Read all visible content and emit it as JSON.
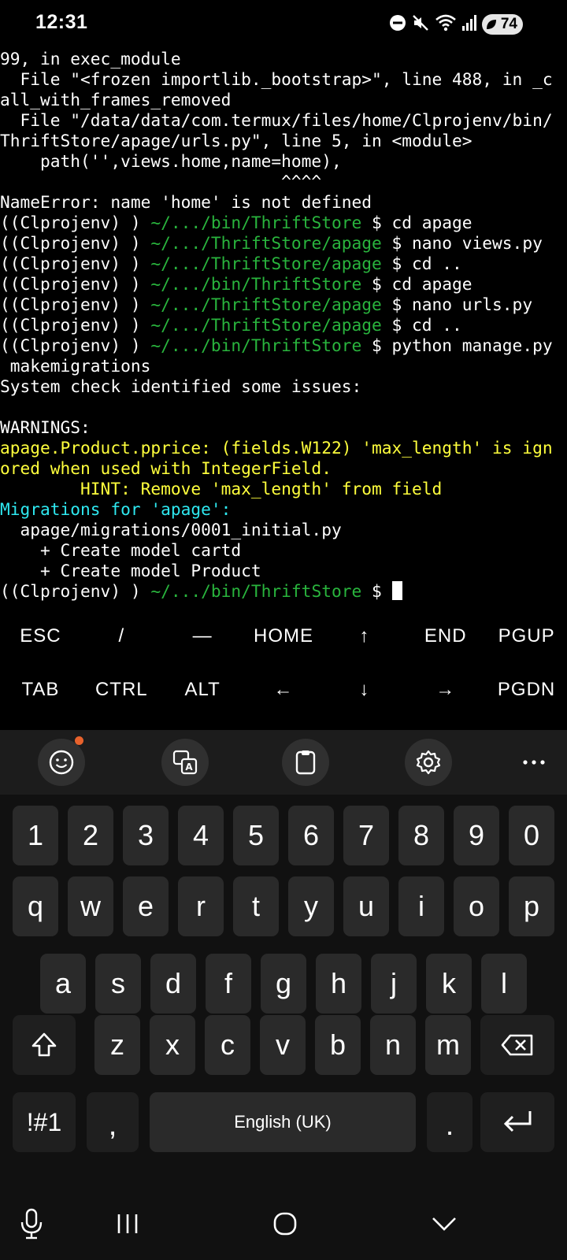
{
  "status_bar": {
    "time": "12:31",
    "battery": "74"
  },
  "terminal": {
    "lines": [
      [
        {
          "t": "99, in exec_module",
          "c": ""
        }
      ],
      [
        {
          "t": "  File \"<frozen importlib._bootstrap>\", line 488, in _c",
          "c": ""
        }
      ],
      [
        {
          "t": "all_with_frames_removed",
          "c": ""
        }
      ],
      [
        {
          "t": "  File \"/data/data/com.termux/files/home/Clprojenv/bin/",
          "c": ""
        }
      ],
      [
        {
          "t": "ThriftStore/apage/urls.py\", line 5, in <module>",
          "c": ""
        }
      ],
      [
        {
          "t": "    path('',views.home,name=home),",
          "c": ""
        }
      ],
      [
        {
          "t": "                            ^^^^",
          "c": ""
        }
      ],
      [
        {
          "t": "NameError: name 'home' is not defined",
          "c": ""
        }
      ],
      [
        {
          "t": "((Clprojenv) ) ",
          "c": ""
        },
        {
          "t": "~/.../bin/ThriftStore",
          "c": "g"
        },
        {
          "t": " $ cd apage",
          "c": ""
        }
      ],
      [
        {
          "t": "((Clprojenv) ) ",
          "c": ""
        },
        {
          "t": "~/.../ThriftStore/apage",
          "c": "g"
        },
        {
          "t": " $ nano views.py",
          "c": ""
        }
      ],
      [
        {
          "t": "((Clprojenv) ) ",
          "c": ""
        },
        {
          "t": "~/.../ThriftStore/apage",
          "c": "g"
        },
        {
          "t": " $ cd ..",
          "c": ""
        }
      ],
      [
        {
          "t": "((Clprojenv) ) ",
          "c": ""
        },
        {
          "t": "~/.../bin/ThriftStore",
          "c": "g"
        },
        {
          "t": " $ cd apage",
          "c": ""
        }
      ],
      [
        {
          "t": "((Clprojenv) ) ",
          "c": ""
        },
        {
          "t": "~/.../ThriftStore/apage",
          "c": "g"
        },
        {
          "t": " $ nano urls.py",
          "c": ""
        }
      ],
      [
        {
          "t": "((Clprojenv) ) ",
          "c": ""
        },
        {
          "t": "~/.../ThriftStore/apage",
          "c": "g"
        },
        {
          "t": " $ cd ..",
          "c": ""
        }
      ],
      [
        {
          "t": "((Clprojenv) ) ",
          "c": ""
        },
        {
          "t": "~/.../bin/ThriftStore",
          "c": "g"
        },
        {
          "t": " $ python manage.py",
          "c": ""
        }
      ],
      [
        {
          "t": " makemigrations",
          "c": ""
        }
      ],
      [
        {
          "t": "System check identified some issues:",
          "c": ""
        }
      ],
      [
        {
          "t": "",
          "c": ""
        }
      ],
      [
        {
          "t": "WARNINGS:",
          "c": ""
        }
      ],
      [
        {
          "t": "apage.Product.pprice: (fields.W122) 'max_length' is ign",
          "c": "y"
        }
      ],
      [
        {
          "t": "ored when used with IntegerField.",
          "c": "y"
        }
      ],
      [
        {
          "t": "        HINT: Remove 'max_length' from field",
          "c": "y"
        }
      ],
      [
        {
          "t": "Migrations for 'apage':",
          "c": "c"
        }
      ],
      [
        {
          "t": "  apage/migrations/0001_initial.py",
          "c": ""
        }
      ],
      [
        {
          "t": "    + Create model cartd",
          "c": ""
        }
      ],
      [
        {
          "t": "    + Create model Product",
          "c": ""
        }
      ],
      [
        {
          "t": "((Clprojenv) ) ",
          "c": ""
        },
        {
          "t": "~/.../bin/ThriftStore",
          "c": "g"
        },
        {
          "t": " $ ",
          "c": ""
        }
      ]
    ]
  },
  "extra_keys": {
    "row1": [
      "ESC",
      "/",
      "—",
      "HOME",
      "↑",
      "END",
      "PGUP"
    ],
    "row2": [
      "TAB",
      "CTRL",
      "ALT",
      "←",
      "↓",
      "→",
      "PGDN"
    ]
  },
  "keyboard": {
    "numbers": [
      "1",
      "2",
      "3",
      "4",
      "5",
      "6",
      "7",
      "8",
      "9",
      "0"
    ],
    "row_q": [
      "q",
      "w",
      "e",
      "r",
      "t",
      "y",
      "u",
      "i",
      "o",
      "p"
    ],
    "row_a": [
      "a",
      "s",
      "d",
      "f",
      "g",
      "h",
      "j",
      "k",
      "l"
    ],
    "row_z": [
      "z",
      "x",
      "c",
      "v",
      "b",
      "n",
      "m"
    ],
    "symbols_label": "!#1",
    "comma": ",",
    "space_label": "English (UK)",
    "period": "."
  },
  "colors": {
    "prompt_path": "#29b43d",
    "warning": "#ffff3c",
    "migrations": "#2ee8f0",
    "notification_dot": "#e8622c"
  }
}
